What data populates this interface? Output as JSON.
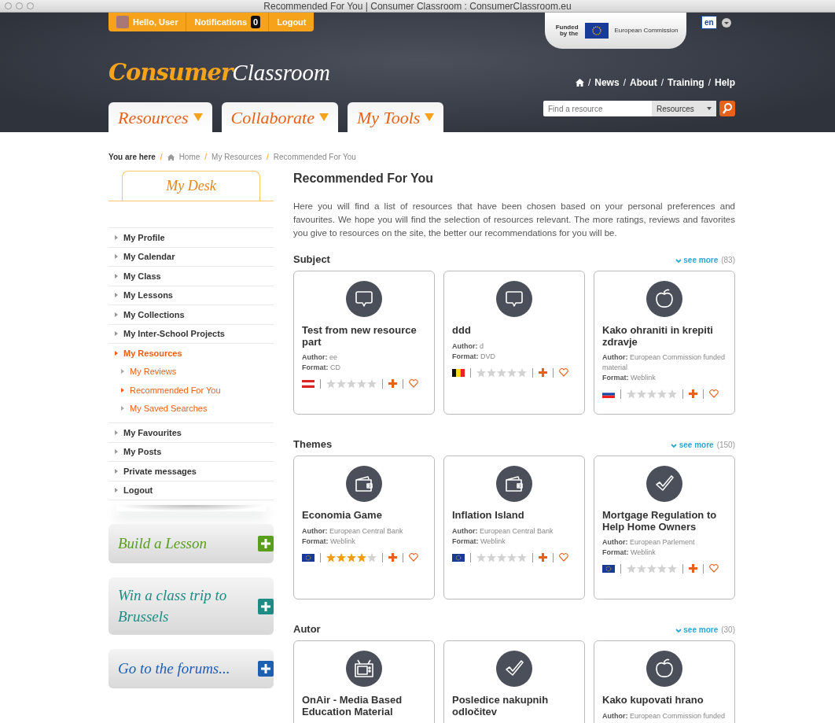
{
  "window": {
    "title": "Recommended For You | Consumer Classroom : ConsumerClassroom.eu"
  },
  "user_bar": {
    "greeting": "Hello, User",
    "notifications": "Notifications",
    "notification_count": "0",
    "logout": "Logout"
  },
  "funding": {
    "funded_by": "Funded by the",
    "commission": "European Commission"
  },
  "language": "en",
  "logo": {
    "first": "Consumer",
    "second": "Classroom"
  },
  "top_nav": {
    "separator": "/",
    "links": [
      "News",
      "About",
      "Training",
      "Help"
    ]
  },
  "tabs": [
    {
      "label": "Resources"
    },
    {
      "label": "Collaborate"
    },
    {
      "label": "My Tools"
    }
  ],
  "search": {
    "placeholder": "Find a resource",
    "scope": "Resources"
  },
  "breadcrumb": {
    "label": "You are here",
    "separator": "/",
    "items": [
      "Home",
      "My Resources",
      "Recommended For You"
    ]
  },
  "sidebar": {
    "title": "My Desk",
    "items": [
      {
        "label": "My Profile",
        "selected": false
      },
      {
        "label": "My Calendar",
        "selected": false
      },
      {
        "label": "My Class",
        "selected": false
      },
      {
        "label": "My Lessons",
        "selected": false
      },
      {
        "label": "My Collections",
        "selected": false
      },
      {
        "label": "My Inter-School Projects",
        "selected": false
      },
      {
        "label": "My Resources",
        "selected": true,
        "children": [
          {
            "label": "My Reviews",
            "selected": false
          },
          {
            "label": "Recommended For You",
            "selected": true
          },
          {
            "label": "My Saved Searches",
            "selected": false
          }
        ]
      },
      {
        "label": "My Favourites",
        "selected": false
      },
      {
        "label": "My Posts",
        "selected": false
      },
      {
        "label": "Private messages",
        "selected": false
      },
      {
        "label": "Logout",
        "selected": false
      }
    ]
  },
  "promos": [
    {
      "label": "Build a Lesson",
      "color": "#5a9e1e"
    },
    {
      "label": "Win a class trip to Brussels",
      "color": "#1e8c84"
    },
    {
      "label": "Go to the forums...",
      "color": "#1d5fb0"
    }
  ],
  "main": {
    "heading": "Recommended For You",
    "intro": "Here you will find a list of resources that have been chosen based on your personal preferences and favourites. We hope you will find the selection of resources relevant. The more ratings, reviews and favorites you give to resources on the site, the better our recommendations for you will be.",
    "sections": [
      {
        "title": "Subject",
        "see_more": "see more",
        "count": "(83)",
        "cards": [
          {
            "kind": "speech",
            "title": "Test from new resource part",
            "author": "**Author:** ee",
            "format": "**Format:** CD",
            "stars": 0
          },
          {
            "kind": "speech",
            "title": "ddd",
            "author": "**Author:** d",
            "format": "**Format:** DVD",
            "stars": 0
          },
          {
            "kind": "apple",
            "title": "Kako ohraniti in krepiti zdravje",
            "author": "**Author:** European Commission funded material",
            "format": "**Format:** Weblink",
            "stars": 0
          }
        ]
      },
      {
        "title": "Themes",
        "see_more": "see more",
        "count": "(150)",
        "cards": [
          {
            "kind": "wallet",
            "title": "Economia Game",
            "author": "**Author:** European Central Bank",
            "format": "**Format:** Weblink",
            "stars": 4
          },
          {
            "kind": "wallet",
            "title": "Inflation Island",
            "author": "**Author:** European Central Bank",
            "format": "**Format:** Weblink",
            "stars": 0
          },
          {
            "kind": "check",
            "title": "Mortgage Regulation to Help Home Owners",
            "author": "**Author:** European Parlement",
            "format": "**Format:** Weblink",
            "stars": 0
          }
        ]
      },
      {
        "title": "Autor",
        "see_more": "see more",
        "count": "(30)",
        "cards": [
          {
            "kind": "tv",
            "title": "OnAir - Media Based Education Material"
          },
          {
            "kind": "check",
            "title": "Posledice nakupnih odločitev"
          },
          {
            "kind": "apple",
            "title": "Kako kupovati hrano",
            "author": "**Author:** European Commission funded"
          }
        ]
      }
    ]
  }
}
